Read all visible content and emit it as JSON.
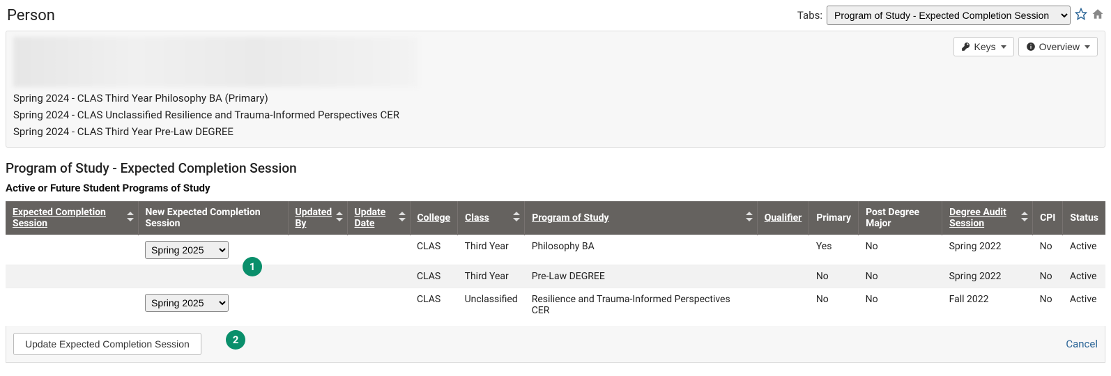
{
  "header": {
    "title": "Person",
    "tabs_label": "Tabs:",
    "tabs_selected": "Program of Study - Expected Completion Session"
  },
  "context": {
    "keys_label": "Keys",
    "overview_label": "Overview",
    "programs": [
      "Spring 2024 - CLAS Third Year Philosophy BA (Primary)",
      "Spring 2024 - CLAS Unclassified Resilience and Trauma-Informed Perspectives CER",
      "Spring 2024 - CLAS Third Year Pre-Law DEGREE"
    ]
  },
  "section": {
    "heading": "Program of Study - Expected Completion Session",
    "subheading": "Active or Future Student Programs of Study"
  },
  "table": {
    "columns": {
      "ecs": "Expected Completion Session",
      "necs": "New Expected Completion Session",
      "updby": "Updated By",
      "upddate": "Update Date",
      "college": "College",
      "class": "Class",
      "pos": "Program of Study",
      "qual": "Qualifier",
      "prim": "Primary",
      "pdm": "Post Degree Major",
      "das": "Degree Audit Session",
      "cpi": "CPI",
      "status": "Status"
    },
    "rows": [
      {
        "ecs": "",
        "necs": "Spring 2025",
        "updby": "",
        "upddate": "",
        "college": "CLAS",
        "class": "Third Year",
        "pos": "Philosophy BA",
        "qual": "",
        "prim": "Yes",
        "pdm": "No",
        "das": "Spring 2022",
        "cpi": "No",
        "status": "Active"
      },
      {
        "ecs": "",
        "necs": "",
        "updby": "",
        "upddate": "",
        "college": "CLAS",
        "class": "Third Year",
        "pos": "Pre-Law DEGREE",
        "qual": "",
        "prim": "No",
        "pdm": "No",
        "das": "Spring 2022",
        "cpi": "No",
        "status": "Active"
      },
      {
        "ecs": "",
        "necs": "Spring 2025",
        "updby": "",
        "upddate": "",
        "college": "CLAS",
        "class": "Unclassified",
        "pos": "Resilience and Trauma-Informed Perspectives CER",
        "qual": "",
        "prim": "No",
        "pdm": "No",
        "das": "Fall 2022",
        "cpi": "No",
        "status": "Active"
      }
    ]
  },
  "footer": {
    "update_button": "Update Expected Completion Session",
    "cancel": "Cancel"
  },
  "annotations": {
    "one": "1",
    "two": "2"
  }
}
